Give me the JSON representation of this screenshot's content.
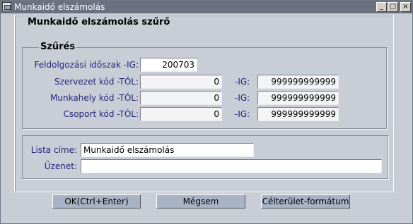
{
  "window": {
    "title": "Munkaidő elszámolás",
    "controls": {
      "minimize": "_",
      "maximize": "□",
      "close": "×"
    }
  },
  "form": {
    "heading": "Munkaidő elszámolás szűrő",
    "filter_group": {
      "label": "Szűrés",
      "period_label": "Feldolgozási időszak -IG:",
      "period_value": "200703",
      "rows": [
        {
          "label": "Szervezet kód -TÓL:",
          "from": "0",
          "to_label": "-IG:",
          "to": "999999999999"
        },
        {
          "label": "Munkahely kód -TÓL:",
          "from": "0",
          "to_label": "-IG:",
          "to": "999999999999"
        },
        {
          "label": "Csoport kód -TÓL:",
          "from": "0",
          "to_label": "-IG:",
          "to": "999999999999"
        }
      ]
    },
    "list_title_label": "Lista címe:",
    "list_title_value": "Munkaidő elszámolás",
    "message_label": "Üzenet:",
    "message_value": ""
  },
  "buttons": {
    "ok": "OK(Ctrl+Enter)",
    "cancel": "Mégsem",
    "target_format": "Célterület-formátum"
  },
  "colors": {
    "titlebar": "#6b7180",
    "background": "#c8cdd6",
    "label_text": "#25257a",
    "button": "#a8b3c6"
  }
}
